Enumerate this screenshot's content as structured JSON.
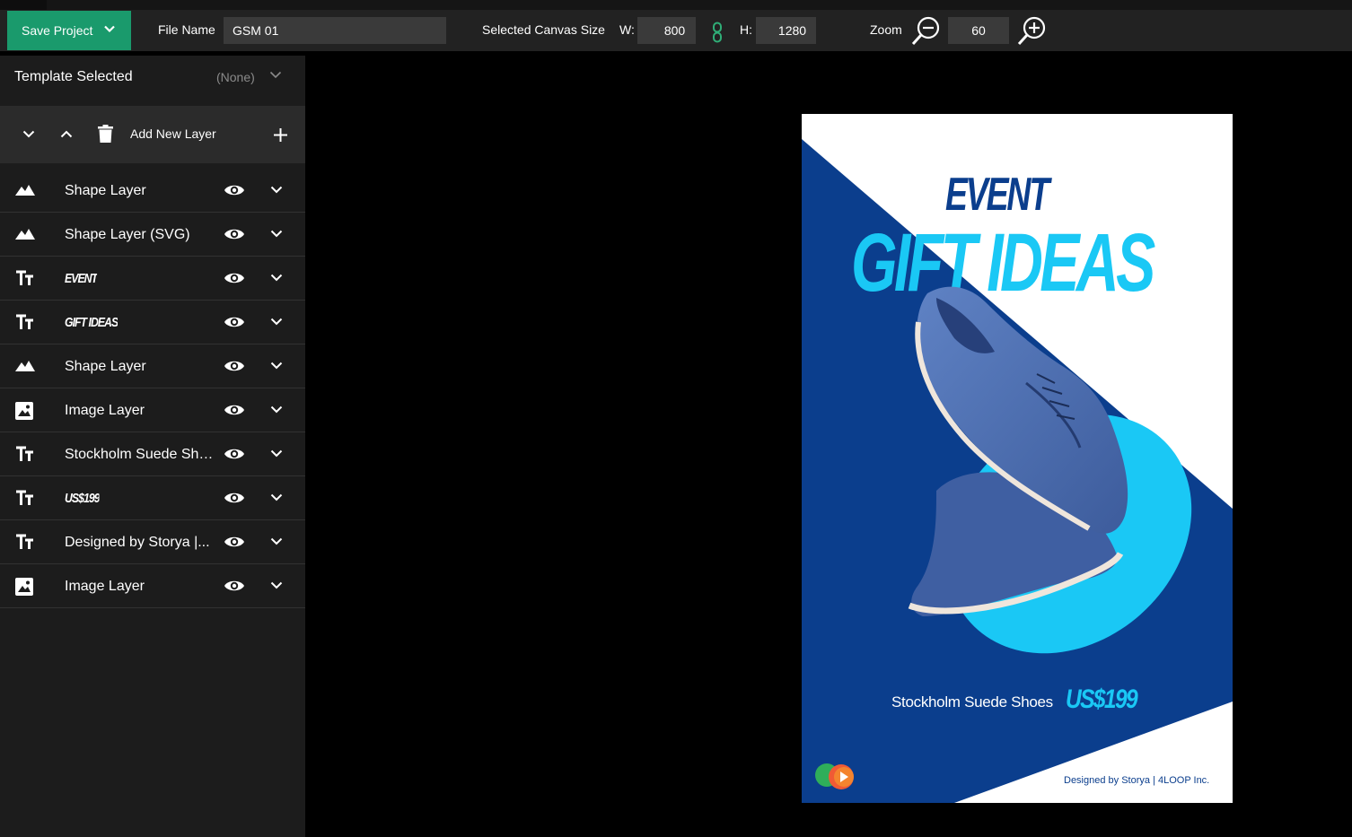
{
  "toolbar": {
    "save_label": "Save Project",
    "file_name_label": "File Name",
    "file_name_value": "GSM 01",
    "canvas_size_label": "Selected Canvas Size",
    "width_label": "W:",
    "width_value": "800",
    "height_label": "H:",
    "height_value": "1280",
    "zoom_label": "Zoom",
    "zoom_value": "60"
  },
  "sidebar": {
    "template_label": "Template Selected",
    "template_value": "(None)",
    "add_layer_label": "Add New Layer",
    "layers": [
      {
        "type": "shape",
        "name": "Shape Layer"
      },
      {
        "type": "shape",
        "name": "Shape Layer (SVG)"
      },
      {
        "type": "text",
        "name": "EVENT"
      },
      {
        "type": "text",
        "name": "GIFT IDEAS"
      },
      {
        "type": "shape",
        "name": "Shape Layer"
      },
      {
        "type": "image",
        "name": "Image Layer"
      },
      {
        "type": "text",
        "name": "Stockholm Suede Shoe..."
      },
      {
        "type": "text",
        "name": "US$199"
      },
      {
        "type": "text",
        "name": "Designed by Storya |..."
      },
      {
        "type": "image",
        "name": "Image Layer"
      }
    ]
  },
  "poster": {
    "headline_small": "EVENT",
    "headline_large": "GIFT IDEAS",
    "product": "Stockholm Suede Shoes",
    "price": "US$199",
    "credit": "Designed by Storya | 4LOOP Inc."
  },
  "colors": {
    "accent_green": "#1a9a6c",
    "poster_navy": "#0b3e8d",
    "poster_cyan": "#1ac8f5",
    "shoe_blue": "#4c6db0"
  }
}
